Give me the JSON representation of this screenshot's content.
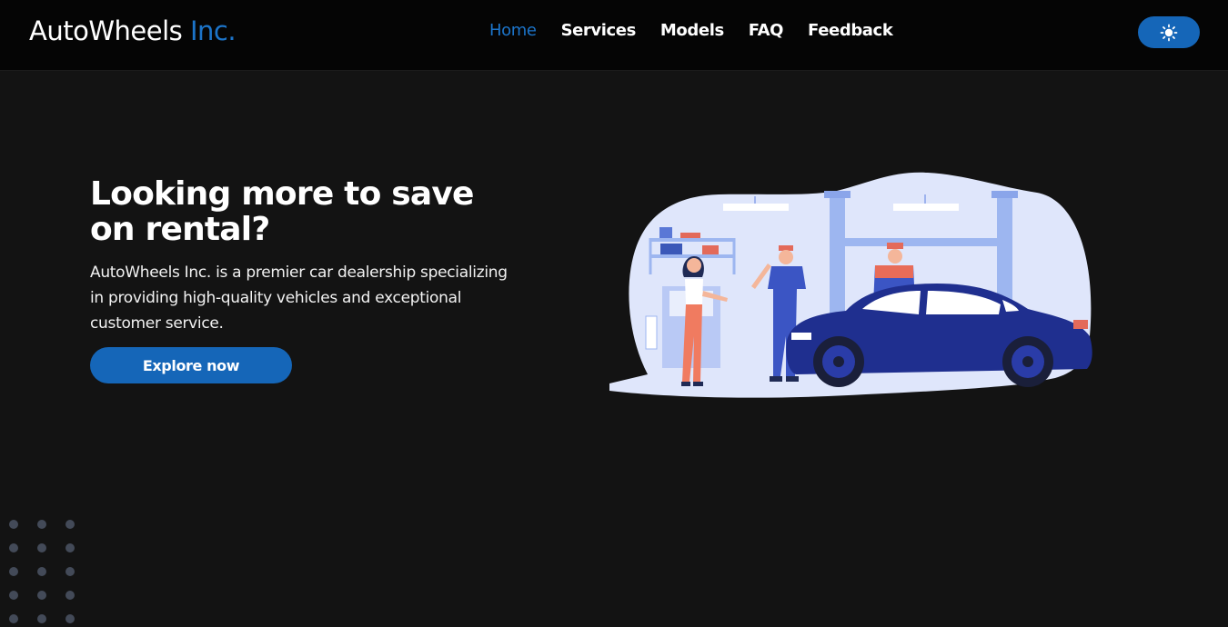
{
  "header": {
    "logo_main": "AutoWheels",
    "logo_accent": "Inc.",
    "nav": [
      {
        "label": "Home",
        "active": true
      },
      {
        "label": "Services",
        "active": false
      },
      {
        "label": "Models",
        "active": false
      },
      {
        "label": "FAQ",
        "active": false
      },
      {
        "label": "Feedback",
        "active": false
      }
    ],
    "theme_toggle_icon": "sun-icon"
  },
  "hero": {
    "title": "Looking more to save on rental?",
    "description": "AutoWheels Inc. is a premier car dealership specializing in providing high-quality vehicles and exceptional customer service.",
    "cta_label": "Explore now"
  },
  "colors": {
    "accent": "#1c74c9",
    "button": "#1566b8",
    "background": "#131313",
    "navbar": "#050505",
    "car": "#1f2f8f",
    "dots": "#434a58"
  }
}
